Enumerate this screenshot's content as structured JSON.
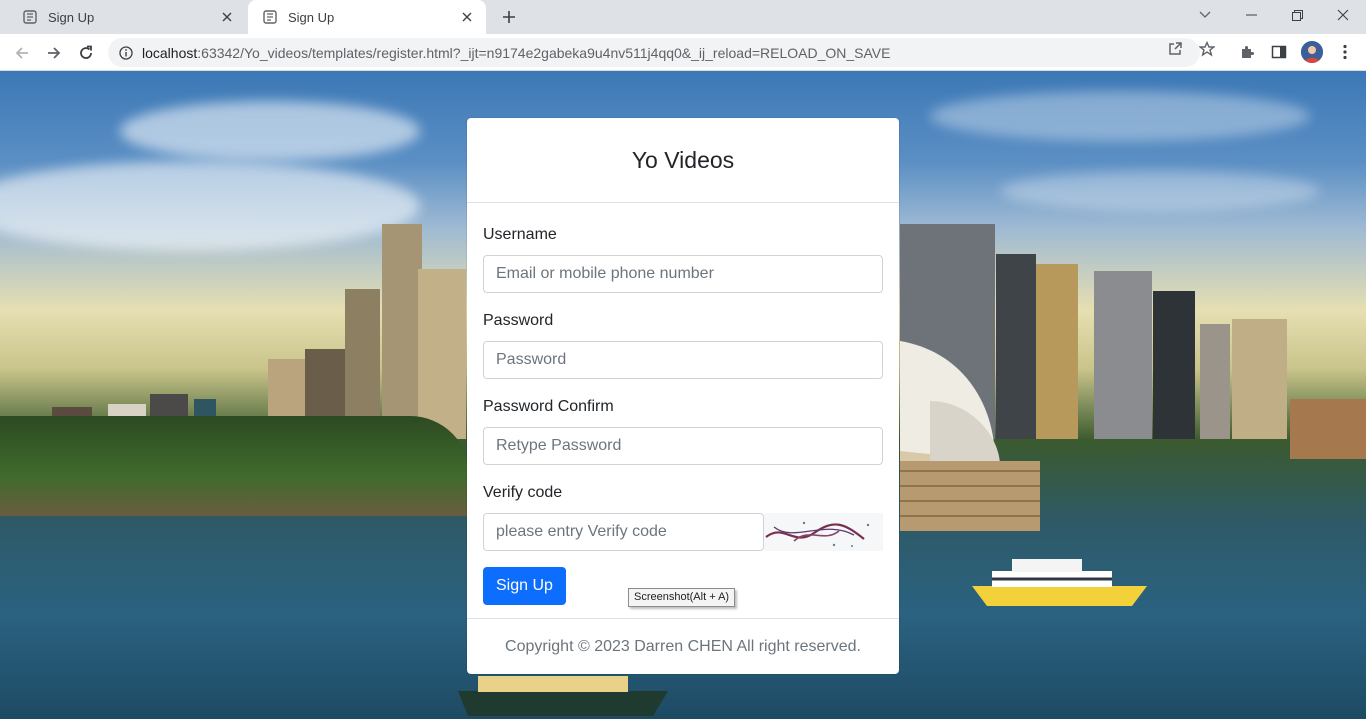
{
  "browser": {
    "tabs": [
      {
        "title": "Sign Up",
        "active": false
      },
      {
        "title": "Sign Up",
        "active": true
      }
    ],
    "url_host": "localhost",
    "url_rest": ":63342/Yo_videos/templates/register.html?_ijt=n9174e2gabeka9u4nv511j4qq0&_ij_reload=RELOAD_ON_SAVE"
  },
  "form": {
    "title": "Yo Videos",
    "username_label": "Username",
    "username_placeholder": "Email or mobile phone number",
    "password_label": "Password",
    "password_placeholder": "Password",
    "confirm_label": "Password Confirm",
    "confirm_placeholder": "Retype Password",
    "verify_label": "Verify code",
    "verify_placeholder": "please entry Verify code",
    "submit_label": "Sign Up",
    "footer": "Copyright © 2023 Darren CHEN All right reserved."
  },
  "tooltip": "Screenshot(Alt + A)",
  "colors": {
    "primary": "#0d6efd",
    "tab_strip": "#dee1e6",
    "omnibox": "#f1f3f4"
  }
}
